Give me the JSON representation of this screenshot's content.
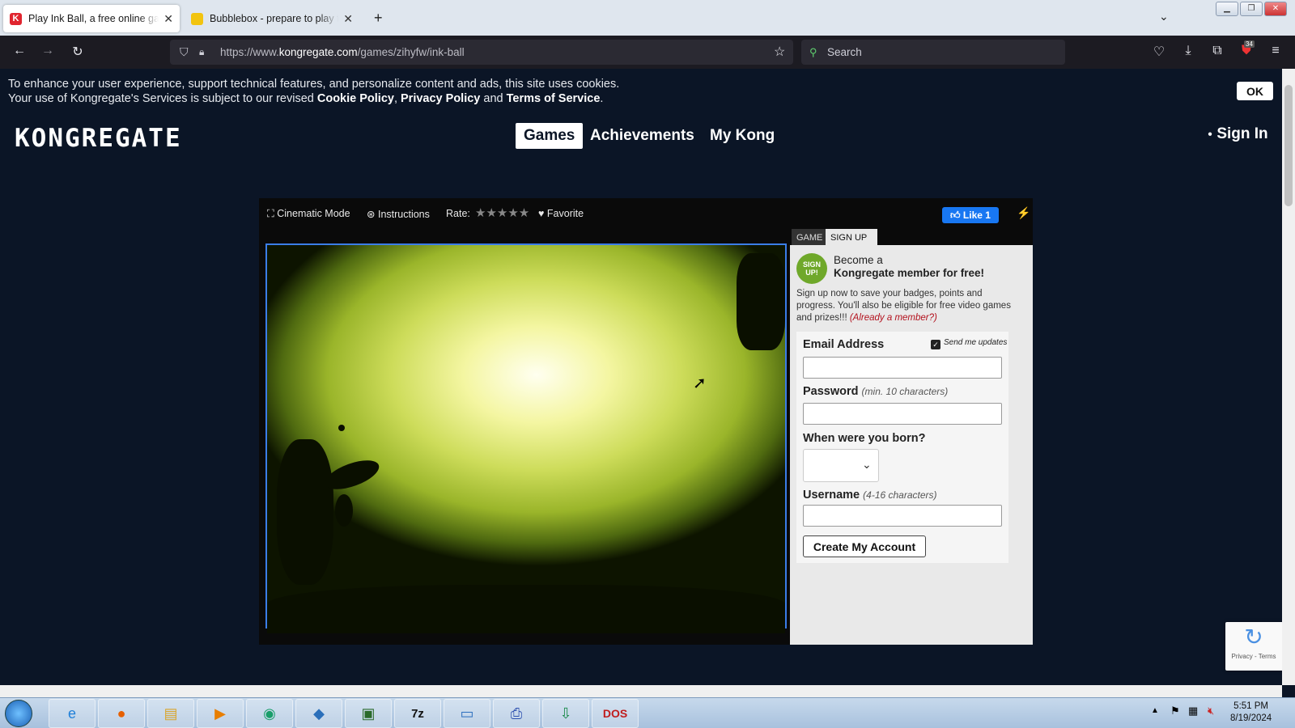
{
  "browser": {
    "tabs": [
      {
        "title": "Play Ink Ball, a free online game",
        "active": true
      },
      {
        "title": "Bubblebox - prepare to play the",
        "active": false
      }
    ],
    "url_prefix": "https://www.",
    "url_domain": "kongregate.com",
    "url_path": "/games/zihyfw/ink-ball",
    "search_placeholder": "Search",
    "badge_count": "34"
  },
  "cookie_banner": {
    "line1": "To enhance your user experience, support technical features, and personalize content and ads, this site uses cookies.",
    "line2_start": "Your use of Kongregate's Services is subject to our revised ",
    "cookie_policy": "Cookie Policy",
    "comma": ", ",
    "privacy_policy": "Privacy Policy",
    "and": " and ",
    "terms": "Terms of Service",
    "period": ".",
    "ok": "OK"
  },
  "header": {
    "logo": "KONGREGATE",
    "nav": [
      "Games",
      "Achievements",
      "My Kong"
    ],
    "sign_in": "Sign In"
  },
  "game_bar": {
    "cinematic": "Cinematic Mode",
    "instructions": "Instructions",
    "rate": "Rate:",
    "stars": "★★★★★",
    "favorite": "Favorite",
    "like": "Like 1"
  },
  "side_tabs": {
    "game": "GAME",
    "signup": "SIGN UP"
  },
  "signup": {
    "badge": "SIGN UP!",
    "become": "Become a",
    "member": "Kongregate member for free!",
    "blurb": "Sign up now to save your badges, points and progress. You'll also be eligible for free video games and prizes!!! ",
    "already": "(Already a member?)",
    "email_label": "Email Address",
    "send_updates": "Send me updates",
    "password_label": "Password",
    "password_hint": "(min. 10 characters)",
    "born_label": "When were you born?",
    "username_label": "Username",
    "username_hint": "(4-16 characters)",
    "create": "Create My Account"
  },
  "recaptcha": {
    "text": "Privacy - Terms"
  },
  "taskbar": {
    "time": "5:51 PM",
    "date": "8/19/2024"
  },
  "colors": {
    "page_bg": "#0b1526",
    "accent": "#3b7de8",
    "like_blue": "#1877f2"
  }
}
